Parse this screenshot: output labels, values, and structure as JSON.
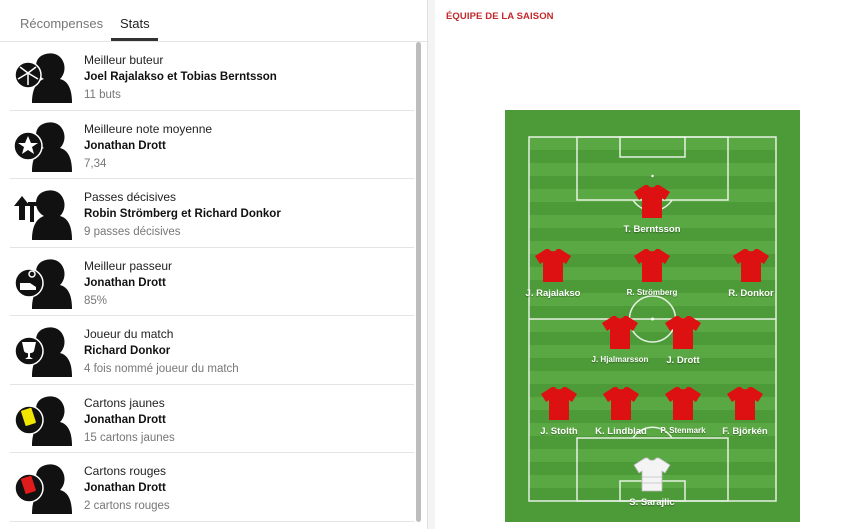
{
  "tabs": [
    "Récompenses",
    "Stats"
  ],
  "stats": [
    {
      "title": "Meilleur buteur",
      "name": "Joel Rajalakso et Tobias Berntsson",
      "value": "11 buts",
      "icon": "ball-icon"
    },
    {
      "title": "Meilleure note moyenne",
      "name": "Jonathan Drott",
      "value": "7,34",
      "icon": "star-icon"
    },
    {
      "title": "Passes décisives",
      "name": "Robin Strömberg et Richard Donkor",
      "value": "9 passes décisives",
      "icon": "assist-arrow-icon"
    },
    {
      "title": "Meilleur passeur",
      "name": "Jonathan Drott",
      "value": "85%",
      "icon": "boot-icon"
    },
    {
      "title": "Joueur du match",
      "name": "Richard Donkor",
      "value": "4 fois nommé joueur du match",
      "icon": "trophy-icon"
    },
    {
      "title": "Cartons jaunes",
      "name": "Jonathan Drott",
      "value": "15 cartons jaunes",
      "icon": "yellow-card-icon"
    },
    {
      "title": "Cartons rouges",
      "name": "Jonathan Drott",
      "value": "2 cartons rouges",
      "icon": "red-card-icon"
    }
  ],
  "team": {
    "title": "ÉQUIPE DE LA SAISON",
    "players": {
      "st": "T. Berntsson",
      "lm": "J. Rajalakso",
      "cam": "R. Strömberg",
      "rm": "R. Donkor",
      "cm1": "J. Hjalmarsson",
      "cm2": "J. Drott",
      "lb": "J. Stolth",
      "cb1": "K. Lindblad",
      "cb2": "P. Stenmark",
      "rb": "F. Björkén",
      "gk": "S. Sarajlic"
    }
  },
  "colors": {
    "accent": "#c3282a",
    "pitch_light": "#5aa843",
    "pitch_dark": "#4c9a38",
    "shirt": "#dd1111"
  }
}
